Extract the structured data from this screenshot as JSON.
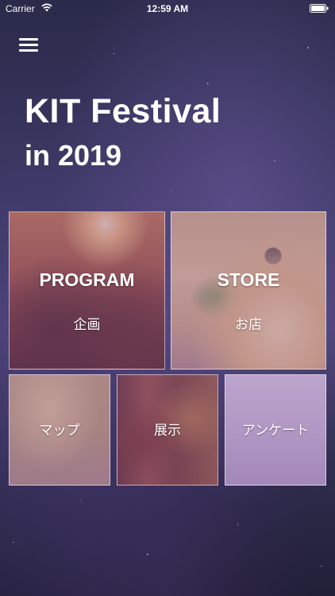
{
  "status_bar": {
    "carrier": "Carrier",
    "time": "12:59 AM",
    "wifi_icon": "wifi-icon",
    "battery_icon": "battery-icon"
  },
  "header": {
    "menu_icon": "hamburger-menu-icon",
    "title": "KIT Festival",
    "subtitle": "in 2019"
  },
  "tiles": {
    "program": {
      "title": "PROGRAM",
      "subtitle": "企画"
    },
    "store": {
      "title": "STORE",
      "subtitle": "お店"
    },
    "map": {
      "label": "マップ"
    },
    "exhibit": {
      "label": "展示"
    },
    "survey": {
      "label": "アンケート"
    }
  },
  "colors": {
    "text": "#ffffff",
    "overlay": "#9a6ab0"
  }
}
